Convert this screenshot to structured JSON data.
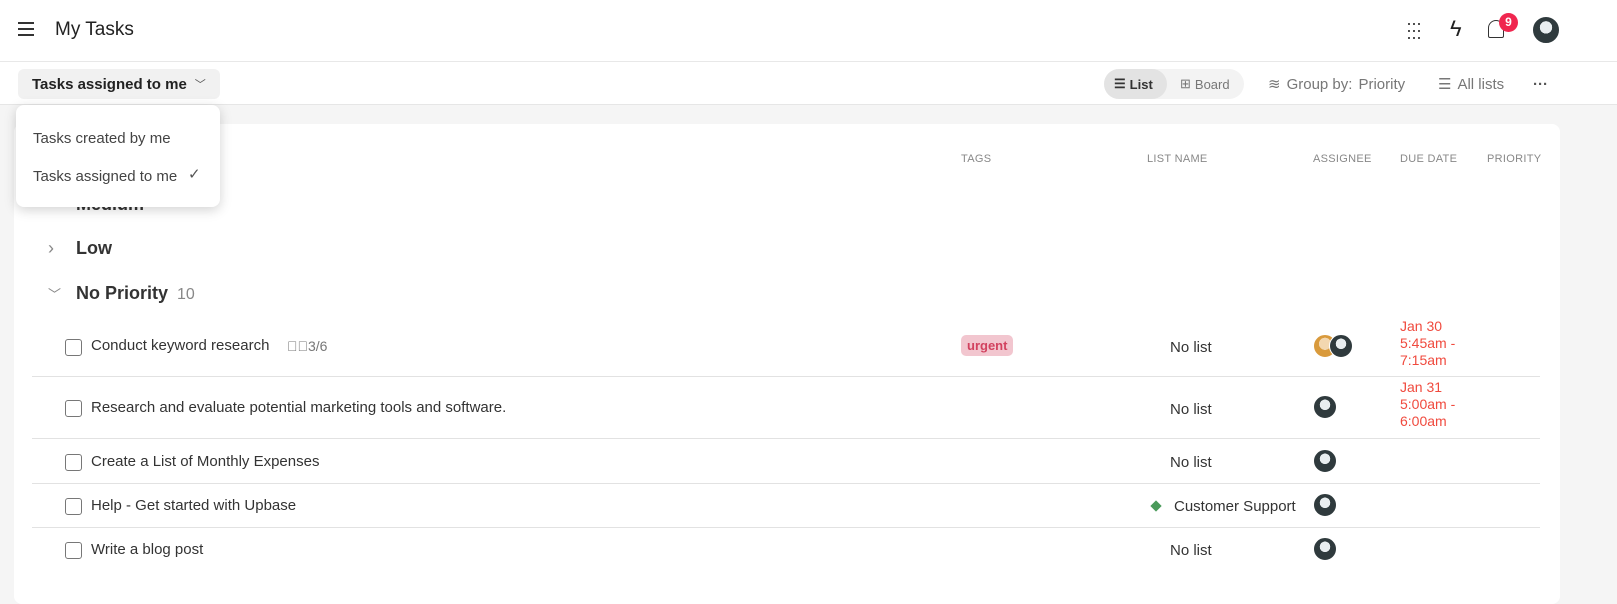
{
  "header": {
    "title": "My Tasks",
    "notification_count": "9"
  },
  "toolbar": {
    "filter_label": "Tasks assigned to me",
    "view_list": "List",
    "view_board": "Board",
    "group_by_label": "Group by:",
    "group_by_value": "Priority",
    "all_lists": "All lists"
  },
  "dropdown": {
    "options": [
      {
        "label": "Tasks created by me",
        "selected": false
      },
      {
        "label": "Tasks assigned to me",
        "selected": true
      }
    ]
  },
  "columns": {
    "tags": "TAGS",
    "list_name": "LIST NAME",
    "assignee": "ASSIGNEE",
    "due_date": "DUE DATE",
    "priority": "PRIORITY"
  },
  "groups": {
    "medium": "Medium",
    "low": "Low",
    "none": "No Priority",
    "none_count": "10"
  },
  "tasks": [
    {
      "name": "Conduct keyword research",
      "subtasks": "3/6",
      "tag": "urgent",
      "list": "No list",
      "due1": "Jan 30",
      "due2": "5:45am -",
      "due3": "7:15am"
    },
    {
      "name": "Research and evaluate potential marketing tools and software.",
      "list": "No list",
      "due1": "Jan 31",
      "due2": "5:00am -",
      "due3": "6:00am"
    },
    {
      "name": "Create a List of Monthly Expenses",
      "list": "No list"
    },
    {
      "name": "Help - Get started with Upbase",
      "list": "Customer Support"
    },
    {
      "name": "Write a blog post",
      "list": "No list"
    }
  ],
  "colors": {
    "due": "#f04a3e",
    "badge": "#f0264f",
    "tag_bg": "#f2c6cf",
    "tag_text": "#d2425f",
    "list_dot": "#4a9a5a"
  }
}
